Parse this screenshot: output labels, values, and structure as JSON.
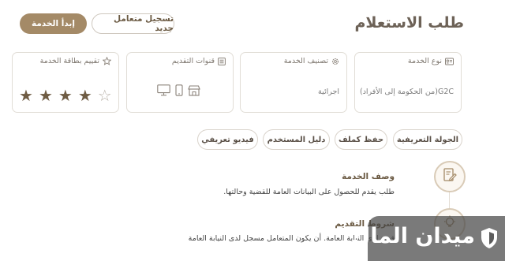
{
  "header": {
    "title": "طلب الاستعلام",
    "register_button": "تسجيل متعامل جديد",
    "start_button": "إبدأ الخدمة"
  },
  "cards": {
    "service_type": {
      "label": "نوع الخدمة",
      "value": "G2C(من الحكومة إلى الأفراد)"
    },
    "classification": {
      "label": "تصنيف الخدمة",
      "value": "اجرائية"
    },
    "channels": {
      "label": "قنوات التقديم"
    },
    "rating": {
      "label": "تقييم بطاقة الخدمة",
      "stars_filled": 4,
      "stars_total": 5
    }
  },
  "chips": {
    "tour": "الجولة التعريفية",
    "save_pdf": "حفظ كملف",
    "user_guide": "دليل المستخدم",
    "intro_video": "فيديو تعريفي"
  },
  "sections": {
    "description": {
      "title": "وصف الخدمة",
      "text": "طلب يقدم للحصول على البيانات العامة للقضية وحالتها."
    },
    "conditions": {
      "title": "شروط التقديم",
      "text": "قيدة لدى النيابة العامة. أن يكون المتعامل مسجل لدى النيابة العامة"
    }
  },
  "watermark": {
    "text": "ميدان المال"
  },
  "colors": {
    "accent": "#a48a67",
    "title": "#6d6257",
    "star_filled": "#6f5c43",
    "star_empty": "#b9b2a8"
  }
}
